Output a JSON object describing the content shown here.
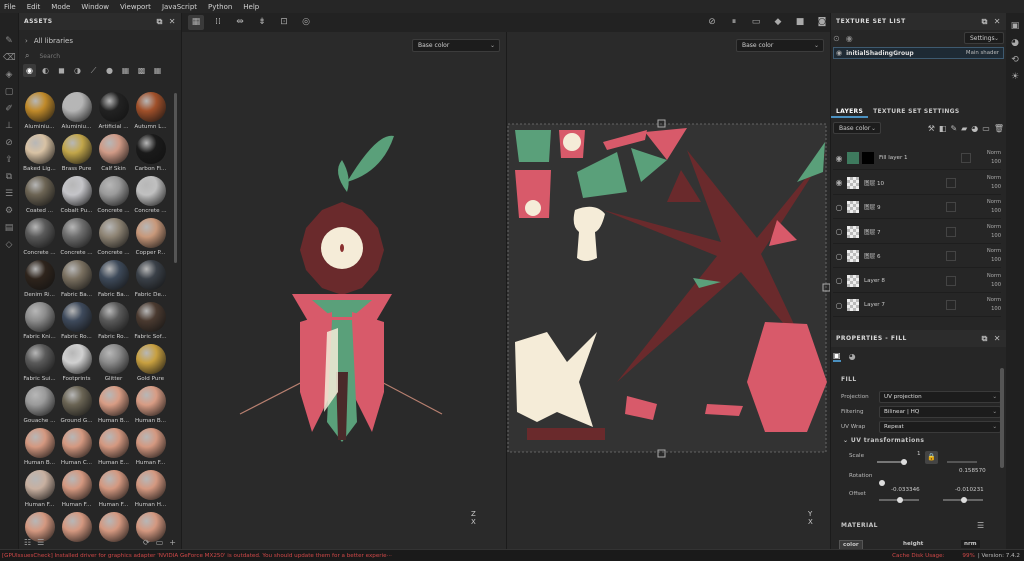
{
  "menu": [
    "File",
    "Edit",
    "Mode",
    "Window",
    "Viewport",
    "JavaScript",
    "Python",
    "Help"
  ],
  "assets": {
    "title": "ASSETS",
    "library": "All libraries",
    "search_placeholder": "Search",
    "items": [
      {
        "label": "Aluminiu...",
        "color": "#c08a2a"
      },
      {
        "label": "Aluminiu...",
        "color": "#b5b5b5"
      },
      {
        "label": "Artificial ...",
        "color": "#222222"
      },
      {
        "label": "Autumn L...",
        "color": "#a0502a"
      },
      {
        "label": "Baked Lig...",
        "color": "#d8c2a4"
      },
      {
        "label": "Brass Pure",
        "color": "#c2a64a"
      },
      {
        "label": "Calf Skin",
        "color": "#d09a86"
      },
      {
        "label": "Carbon Fi...",
        "color": "#1a1a1a"
      },
      {
        "label": "Coated ...",
        "color": "#6c6454"
      },
      {
        "label": "Cobalt Pu...",
        "color": "#c4c4c8"
      },
      {
        "label": "Concrete ...",
        "color": "#9a9a9a"
      },
      {
        "label": "Concrete ...",
        "color": "#c0c0c0"
      },
      {
        "label": "Concrete ...",
        "color": "#5a5a5a"
      },
      {
        "label": "Concrete ...",
        "color": "#6e6e6e"
      },
      {
        "label": "Concrete ...",
        "color": "#8e8474"
      },
      {
        "label": "Copper P...",
        "color": "#c8987a"
      },
      {
        "label": "Denim Ri...",
        "color": "#2e241c"
      },
      {
        "label": "Fabric Ba...",
        "color": "#7a7060"
      },
      {
        "label": "Fabric Ba...",
        "color": "#3e4a5a"
      },
      {
        "label": "Fabric De...",
        "color": "#3a4048"
      },
      {
        "label": "Fabric Kni...",
        "color": "#8c8c8c"
      },
      {
        "label": "Fabric Ro...",
        "color": "#3e4a5c"
      },
      {
        "label": "Fabric Ro...",
        "color": "#5a5a5a"
      },
      {
        "label": "Fabric Sof...",
        "color": "#4a3a30"
      },
      {
        "label": "Fabric Sui...",
        "color": "#5a5a5a"
      },
      {
        "label": "Footprints",
        "color": "#d0d0d0"
      },
      {
        "label": "Glitter",
        "color": "#8a8a8a"
      },
      {
        "label": "Gold Pure",
        "color": "#c8a040"
      },
      {
        "label": "Gouache ...",
        "color": "#9a9a9a"
      },
      {
        "label": "Ground G...",
        "color": "#6a6454"
      },
      {
        "label": "Human B...",
        "color": "#d89c84"
      },
      {
        "label": "Human B...",
        "color": "#d89c84"
      },
      {
        "label": "Human B...",
        "color": "#d49880"
      },
      {
        "label": "Human C...",
        "color": "#d49880"
      },
      {
        "label": "Human E...",
        "color": "#d49880"
      },
      {
        "label": "Human F...",
        "color": "#d49880"
      },
      {
        "label": "Human F...",
        "color": "#c8b0a0"
      },
      {
        "label": "Human F...",
        "color": "#d49880"
      },
      {
        "label": "Human F...",
        "color": "#d49880"
      },
      {
        "label": "Human H...",
        "color": "#d49880"
      },
      {
        "label": "",
        "color": "#d49880"
      },
      {
        "label": "",
        "color": "#d49880"
      },
      {
        "label": "",
        "color": "#d49880"
      },
      {
        "label": "",
        "color": "#d49880"
      }
    ]
  },
  "viewport": {
    "left_channel": "Base color",
    "right_channel": "Base color"
  },
  "texture_set_list": {
    "title": "TEXTURE SET LIST",
    "settings": "Settings",
    "set_name": "initialShadingGroup",
    "shader": "Main shader"
  },
  "layers": {
    "tab_layers": "LAYERS",
    "tab_settings": "TEXTURE SET SETTINGS",
    "channel": "Base color",
    "items": [
      {
        "name": "Fill layer 1",
        "blend": "Norm",
        "opacity": "100"
      },
      {
        "name": "图层 10",
        "blend": "Norm",
        "opacity": "100"
      },
      {
        "name": "图层 9",
        "blend": "Norm",
        "opacity": "100"
      },
      {
        "name": "图层 7",
        "blend": "Norm",
        "opacity": "100"
      },
      {
        "name": "图层 6",
        "blend": "Norm",
        "opacity": "100"
      },
      {
        "name": "Layer 8",
        "blend": "Norm",
        "opacity": "100"
      },
      {
        "name": "Layer 7",
        "blend": "Norm",
        "opacity": "100"
      }
    ]
  },
  "properties": {
    "title": "PROPERTIES - FILL",
    "section": "FILL",
    "projection_label": "Projection",
    "projection": "UV projection",
    "filtering_label": "Filtering",
    "filtering": "Bilinear | HQ",
    "uvwrap_label": "UV Wrap",
    "uvwrap": "Repeat",
    "uvtrans": "UV transformations",
    "scale_label": "Scale",
    "scale_val": "1",
    "scale_val2": "0.158570",
    "rotation_label": "Rotation",
    "offset_label": "Offset",
    "offset_x": "-0.033346",
    "offset_y": "-0.010231",
    "material": "MATERIAL",
    "color_btn": "color",
    "height_btn": "height",
    "nrm_btn": "nrm"
  },
  "status": {
    "message": "[GPUIssuesCheck] Installed driver for graphics adapter 'NVIDIA GeForce MX250' is outdated. You should update them for a better experie···",
    "cache": "Cache Disk Usage:",
    "cache_pct": "99%",
    "version": "| Version: 7.4.2"
  },
  "axis": {
    "x": "X",
    "y": "Y",
    "z": "Z"
  }
}
